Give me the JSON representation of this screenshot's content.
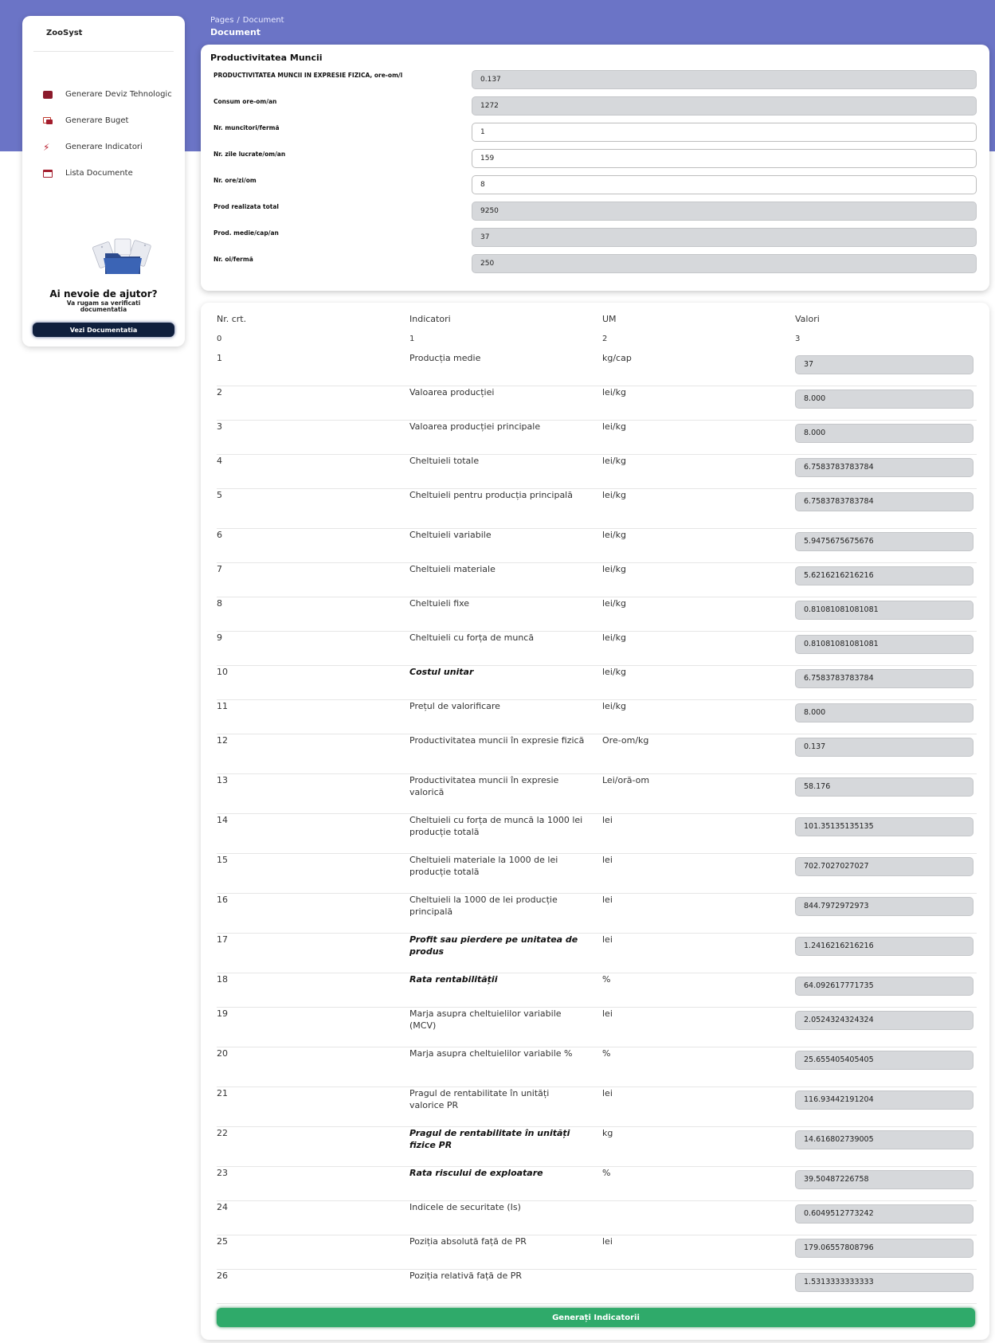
{
  "header": {
    "breadcrumb_root": "Pages",
    "breadcrumb_sep": "/",
    "breadcrumb_current": "Document",
    "page_title": "Document"
  },
  "sidebar": {
    "brand": "ZooSyst",
    "items": [
      {
        "label": "Generare Deviz Tehnologic",
        "icon": "wallet-icon"
      },
      {
        "label": "Generare Buget",
        "icon": "cards-icon"
      },
      {
        "label": "Generare Indicatori",
        "icon": "running-icon"
      },
      {
        "label": "Lista Documente",
        "icon": "calendar-icon"
      }
    ],
    "help_title": "Ai nevoie de ajutor?",
    "help_sub": "Va rugam sa verificati documentatia",
    "doc_button": "Vezi Documentatia"
  },
  "productivity": {
    "title": "Productivitatea Muncii",
    "fields": [
      {
        "label": "PRODUCTIVITATEA MUNCII IN EXPRESIE FIZICA, ore-om/l",
        "value": "0.137",
        "readonly": true
      },
      {
        "label": "Consum ore-om/an",
        "value": "1272",
        "readonly": true
      },
      {
        "label": "Nr. muncitori/fermă",
        "value": "1",
        "readonly": false
      },
      {
        "label": "Nr. zile lucrate/om/an",
        "value": "159",
        "readonly": false
      },
      {
        "label": "Nr. ore/zi/om",
        "value": "8",
        "readonly": false
      },
      {
        "label": "Prod realizata total",
        "value": "9250",
        "readonly": true
      },
      {
        "label": "Prod. medie/cap/an",
        "value": "37",
        "readonly": true
      },
      {
        "label": "Nr. oi/fermă",
        "value": "250",
        "readonly": true
      }
    ]
  },
  "table": {
    "headers": [
      "Nr. crt.",
      "Indicatori",
      "UM",
      "Valori"
    ],
    "subheaders": [
      "0",
      "1",
      "2",
      "3"
    ],
    "rows": [
      {
        "nr": "1",
        "ind": "Producția medie",
        "um": "kg/cap",
        "val": "37",
        "bold": false
      },
      {
        "nr": "2",
        "ind": "Valoarea producției",
        "um": "lei/kg",
        "val": "8.000",
        "bold": false
      },
      {
        "nr": "3",
        "ind": "Valoarea producției principale",
        "um": "lei/kg",
        "val": "8.000",
        "bold": false
      },
      {
        "nr": "4",
        "ind": "Cheltuieli totale",
        "um": "lei/kg",
        "val": "6.7583783783784",
        "bold": false
      },
      {
        "nr": "5",
        "ind": "Cheltuieli pentru producția principală",
        "um": "lei/kg",
        "val": "6.7583783783784",
        "bold": false
      },
      {
        "nr": "6",
        "ind": "Cheltuieli variabile",
        "um": "lei/kg",
        "val": "5.9475675675676",
        "bold": false
      },
      {
        "nr": "7",
        "ind": "Cheltuieli materiale",
        "um": "lei/kg",
        "val": "5.6216216216216",
        "bold": false
      },
      {
        "nr": "8",
        "ind": "Cheltuieli fixe",
        "um": "lei/kg",
        "val": "0.81081081081081",
        "bold": false
      },
      {
        "nr": "9",
        "ind": "Cheltuieli cu forța de muncă",
        "um": "lei/kg",
        "val": "0.81081081081081",
        "bold": false
      },
      {
        "nr": "10",
        "ind": "Costul unitar",
        "um": "lei/kg",
        "val": "6.7583783783784",
        "bold": true
      },
      {
        "nr": "11",
        "ind": "Prețul de valorificare",
        "um": "lei/kg",
        "val": "8.000",
        "bold": false
      },
      {
        "nr": "12",
        "ind": "Productivitatea muncii în expresie fizică",
        "um": "Ore-om/kg",
        "val": "0.137",
        "bold": false
      },
      {
        "nr": "13",
        "ind": "Productivitatea muncii în expresie valorică",
        "um": "Lei/oră-om",
        "val": "58.176",
        "bold": false
      },
      {
        "nr": "14",
        "ind": "Cheltuieli cu forța de muncă la 1000 lei producție totală",
        "um": "lei",
        "val": "101.35135135135",
        "bold": false
      },
      {
        "nr": "15",
        "ind": "Cheltuieli materiale la 1000 de lei producție totală",
        "um": "lei",
        "val": "702.7027027027",
        "bold": false
      },
      {
        "nr": "16",
        "ind": "Cheltuieli la 1000 de lei producție principală",
        "um": "lei",
        "val": "844.7972972973",
        "bold": false
      },
      {
        "nr": "17",
        "ind": "Profit sau pierdere pe unitatea de produs",
        "um": "lei",
        "val": "1.2416216216216",
        "bold": true
      },
      {
        "nr": "18",
        "ind": "Rata rentabilității",
        "um": "%",
        "val": "64.092617771735",
        "bold": true
      },
      {
        "nr": "19",
        "ind": "Marja asupra cheltuielilor variabile (MCV)",
        "um": "lei",
        "val": "2.0524324324324",
        "bold": false
      },
      {
        "nr": "20",
        "ind": "Marja asupra cheltuielilor variabile %",
        "um": "%",
        "val": "25.655405405405",
        "bold": false
      },
      {
        "nr": "21",
        "ind": "Pragul de rentabilitate în unități valorice PR",
        "um": "lei",
        "val": "116.93442191204",
        "bold": false
      },
      {
        "nr": "22",
        "ind": "Pragul de rentabilitate în unități fizice PR",
        "um": "kg",
        "val": "14.616802739005",
        "bold": true
      },
      {
        "nr": "23",
        "ind": "Rata riscului de exploatare",
        "um": "%",
        "val": "39.50487226758",
        "bold": true
      },
      {
        "nr": "24",
        "ind": "Indicele de securitate (Is)",
        "um": "",
        "val": "0.6049512773242",
        "bold": false
      },
      {
        "nr": "25",
        "ind": "Poziția absolută față de PR",
        "um": "lei",
        "val": "179.06557808796",
        "bold": false
      },
      {
        "nr": "26",
        "ind": "Poziția relativă față de PR",
        "um": "",
        "val": "1.5313333333333",
        "bold": false
      }
    ],
    "generate_button": "Generați Indicatorii"
  }
}
